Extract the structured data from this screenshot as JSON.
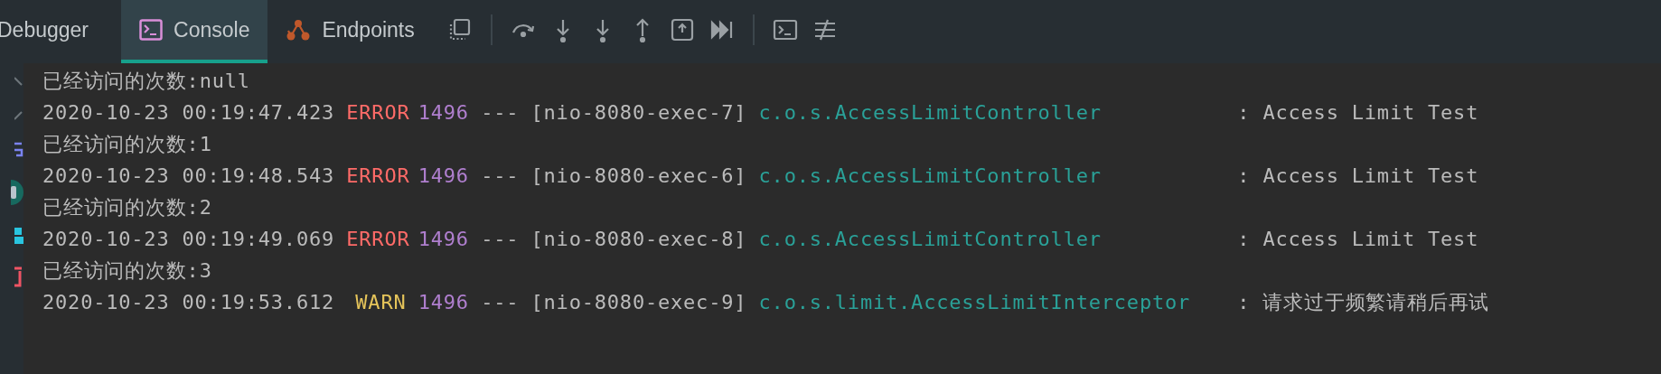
{
  "tabs": [
    {
      "label": "Debugger",
      "kind": "plain",
      "selected": false
    },
    {
      "label": "Console",
      "kind": "console",
      "selected": true
    },
    {
      "label": "Endpoints",
      "kind": "endpoints",
      "selected": false
    }
  ],
  "console_lines": [
    {
      "kind": "plain",
      "text": "已经访问的次数:null"
    },
    {
      "kind": "log",
      "timestamp": "2020-10-23 00:19:47.423",
      "severity": "ERROR",
      "color": "#ff6b68",
      "pid": "1496",
      "separator": "---",
      "thread": "[nio-8080-exec-7]",
      "logger": "c.o.s.AccessLimitController",
      "message": ": Access Limit Test"
    },
    {
      "kind": "plain",
      "text": "已经访问的次数:1"
    },
    {
      "kind": "log",
      "timestamp": "2020-10-23 00:19:48.543",
      "severity": "ERROR",
      "color": "#ff6b68",
      "pid": "1496",
      "separator": "---",
      "thread": "[nio-8080-exec-6]",
      "logger": "c.o.s.AccessLimitController",
      "message": ": Access Limit Test"
    },
    {
      "kind": "plain",
      "text": "已经访问的次数:2"
    },
    {
      "kind": "log",
      "timestamp": "2020-10-23 00:19:49.069",
      "severity": "ERROR",
      "color": "#ff6b68",
      "pid": "1496",
      "separator": "---",
      "thread": "[nio-8080-exec-8]",
      "logger": "c.o.s.AccessLimitController",
      "message": ": Access Limit Test"
    },
    {
      "kind": "plain",
      "text": "已经访问的次数:3"
    },
    {
      "kind": "log",
      "timestamp": "2020-10-23 00:19:53.612",
      "severity": "WARN",
      "color": "#e5c45a",
      "pid": "1496",
      "separator": "---",
      "thread": "[nio-8080-exec-9]",
      "logger": "c.o.s.limit.AccessLimitInterceptor",
      "message": ": 请求过于频繁请稍后再试"
    }
  ]
}
